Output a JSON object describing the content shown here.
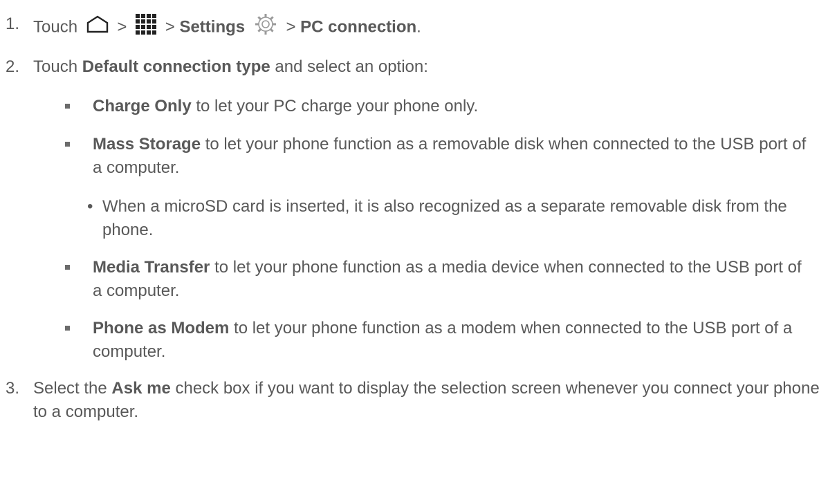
{
  "step1": {
    "num": "1.",
    "touch": "Touch",
    "sep": ">",
    "settings": "Settings",
    "pc_connection": "PC connection",
    "end": "."
  },
  "step2": {
    "num": "2.",
    "pre": "Touch ",
    "bold": "Default connection type",
    "post": " and select an option:"
  },
  "options": [
    {
      "bold": "Charge Only",
      "rest": " to let your PC charge your phone only."
    },
    {
      "bold": " Mass Storage",
      "rest": " to let your phone function as a removable disk when connected to the USB port of a computer."
    },
    {
      "bold": "Media Transfer",
      "rest": " to let your phone function as a media device when connected to the USB port of a computer."
    },
    {
      "bold": "Phone as Modem",
      "rest": " to let your phone function as a modem when connected to the USB port of a computer."
    }
  ],
  "mass_storage_note": {
    "dot": "•",
    "text": "When a microSD card is inserted, it is also recognized as a separate removable disk from the phone."
  },
  "step3": {
    "num": "3.",
    "pre": "Select the ",
    "bold": "Ask me",
    "post": " check box if you want to display the selection screen whenever you connect your phone to a computer."
  },
  "icons": {
    "home": "home-icon",
    "apps": "apps-grid-icon",
    "settings": "settings-gear-icon"
  }
}
